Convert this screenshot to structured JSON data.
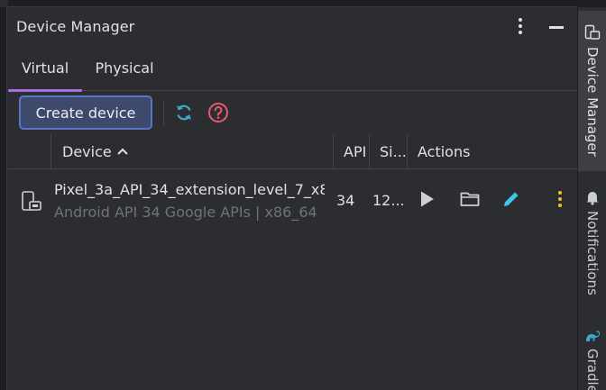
{
  "panel": {
    "title": "Device Manager"
  },
  "tabs": [
    {
      "label": "Virtual",
      "active": true
    },
    {
      "label": "Physical",
      "active": false
    }
  ],
  "toolbar": {
    "create_label": "Create device"
  },
  "table": {
    "columns": [
      "Device",
      "API",
      "Si...",
      "Actions"
    ],
    "sort": "ascending",
    "rows": [
      {
        "name": "Pixel_3a_API_34_extension_level_7_x8...",
        "subtitle": "Android API 34 Google APIs | x86_64",
        "api": "34",
        "size": "12..."
      }
    ]
  },
  "right_strip": {
    "items": [
      {
        "label": "Device Manager",
        "icon": "device-manager-icon",
        "active": true
      },
      {
        "label": "Notifications",
        "icon": "bell-icon",
        "active": false
      },
      {
        "label": "Gradle",
        "icon": "gradle-icon",
        "active": false
      }
    ]
  },
  "colors": {
    "accent": "#a571e6",
    "primary_button": "#3d4a6b",
    "primary_border": "#5875c6",
    "refresh": "#3ea8c9",
    "help": "#e65a6f",
    "edit": "#3ec6e8",
    "more": "#f5c518"
  }
}
